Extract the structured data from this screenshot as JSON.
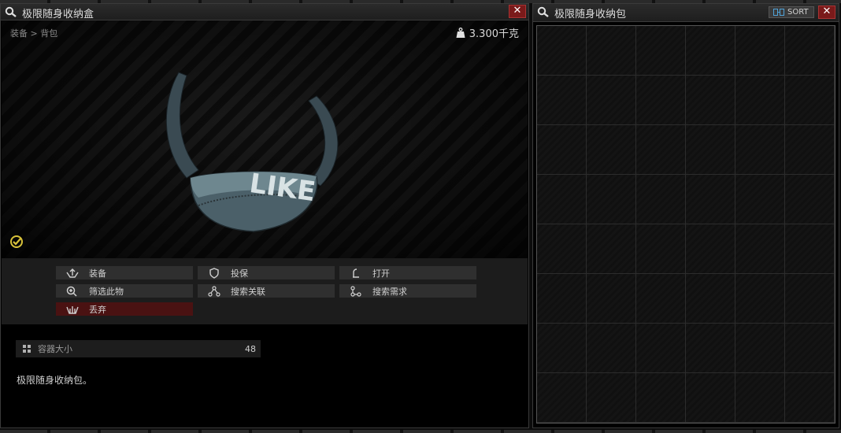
{
  "inspect_window": {
    "title": "极限随身收纳盒",
    "close_glyph": "✕",
    "breadcrumb": {
      "parent": "装备",
      "separator": ">",
      "current": "背包"
    },
    "weight": "3.300千克",
    "actions": [
      {
        "id": "equip",
        "label": "装备",
        "icon": "equip-icon"
      },
      {
        "id": "insure",
        "label": "投保",
        "icon": "shield-icon"
      },
      {
        "id": "open",
        "label": "打开",
        "icon": "open-icon"
      },
      {
        "id": "filter",
        "label": "筛选此物",
        "icon": "magnify-plus-icon"
      },
      {
        "id": "search-related",
        "label": "搜索关联",
        "icon": "nodes-icon"
      },
      {
        "id": "search-required",
        "label": "搜索需求",
        "icon": "nodes-icon"
      },
      {
        "id": "discard",
        "label": "丢弃",
        "icon": "discard-icon"
      }
    ],
    "stat": {
      "label": "容器大小",
      "value": "48",
      "icon": "grid-icon"
    },
    "description": "极限随身收纳包。",
    "item_print": "LIKE"
  },
  "container_window": {
    "title": "极限随身收纳包",
    "sort_label": "SORT",
    "close_glyph": "✕",
    "grid": {
      "columns": 6,
      "rows": 8
    }
  },
  "colors": {
    "danger": "#4a1212",
    "close": "#7a1a1a",
    "checkmark": "#d8c23a",
    "sort_icon": "#4fa3d9"
  }
}
